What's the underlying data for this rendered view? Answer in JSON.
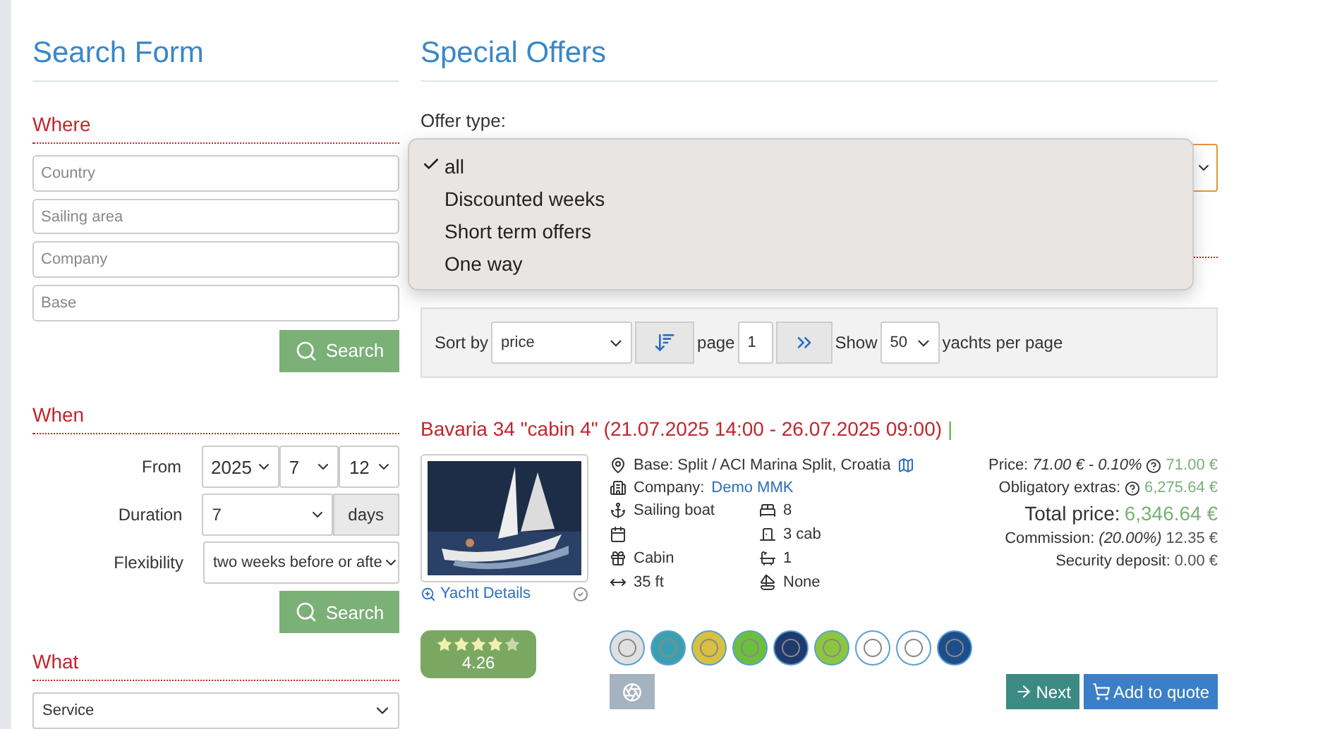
{
  "search_form": {
    "title": "Search Form",
    "where": {
      "heading": "Where",
      "fields": [
        {
          "placeholder": "Country"
        },
        {
          "placeholder": "Sailing area"
        },
        {
          "placeholder": "Company"
        },
        {
          "placeholder": "Base"
        }
      ],
      "button": "Search"
    },
    "when": {
      "heading": "When",
      "from_label": "From",
      "from": [
        "2025",
        "7",
        "12"
      ],
      "duration_label": "Duration",
      "duration": "7",
      "duration_unit": "days",
      "flexibility_label": "Flexibility",
      "flexibility": "two weeks before or afte",
      "button": "Search"
    },
    "what": {
      "heading": "What",
      "service": "Service"
    }
  },
  "offers": {
    "title": "Special Offers",
    "offer_type_label": "Offer type:",
    "offer_type_menu": [
      {
        "label": "all",
        "selected": true
      },
      {
        "label": "Discounted weeks",
        "selected": false
      },
      {
        "label": "Short term offers",
        "selected": false
      },
      {
        "label": "One way",
        "selected": false
      }
    ],
    "toolbar": {
      "sort_label": "Sort by",
      "sort": "price",
      "page_label": "page",
      "page": "1",
      "show_label": "Show",
      "per_page": "50",
      "per_page_label": "yachts per page"
    },
    "yacht": {
      "title": "Bavaria 34 \"cabin 4\" (21.07.2025 14:00 - 26.07.2025 09:00)",
      "separator": "|",
      "details_link": "Yacht Details",
      "rating": "4.26",
      "stars": 4.26,
      "base": "Base: Split / ACI Marina Split,  Croatia",
      "company_label": "Company:",
      "company": "Demo MMK",
      "specs": [
        {
          "kind": "anchor",
          "text": "Sailing boat"
        },
        {
          "kind": "berth",
          "text": "8"
        },
        {
          "kind": "calendar"
        },
        {
          "kind": "cabin",
          "text": "3 cab"
        },
        {
          "kind": "gift",
          "text": "Cabin"
        },
        {
          "kind": "wc",
          "text": "1"
        },
        {
          "kind": "length",
          "text": "35 ft"
        },
        {
          "kind": "sail",
          "text": "None"
        }
      ],
      "prices": [
        {
          "kind": "price",
          "label": "Price:",
          "note": "71.00 € - 0.10%",
          "help": true,
          "value": "71.00 €"
        },
        {
          "kind": "extras",
          "label": "Obligatory extras:",
          "help": true,
          "value": "6,275.64 €"
        },
        {
          "kind": "total",
          "label": "Total price:",
          "help": false,
          "value": "6,346.64 €"
        },
        {
          "kind": "commission",
          "label": "Commission:",
          "note": "(20.00%)",
          "help": false,
          "value": "12.35 €"
        },
        {
          "kind": "deposit",
          "label": "Security deposit:",
          "help": false,
          "value": "0.00 €"
        }
      ],
      "next_button": "Next",
      "quote_button": "Add to quote"
    }
  }
}
